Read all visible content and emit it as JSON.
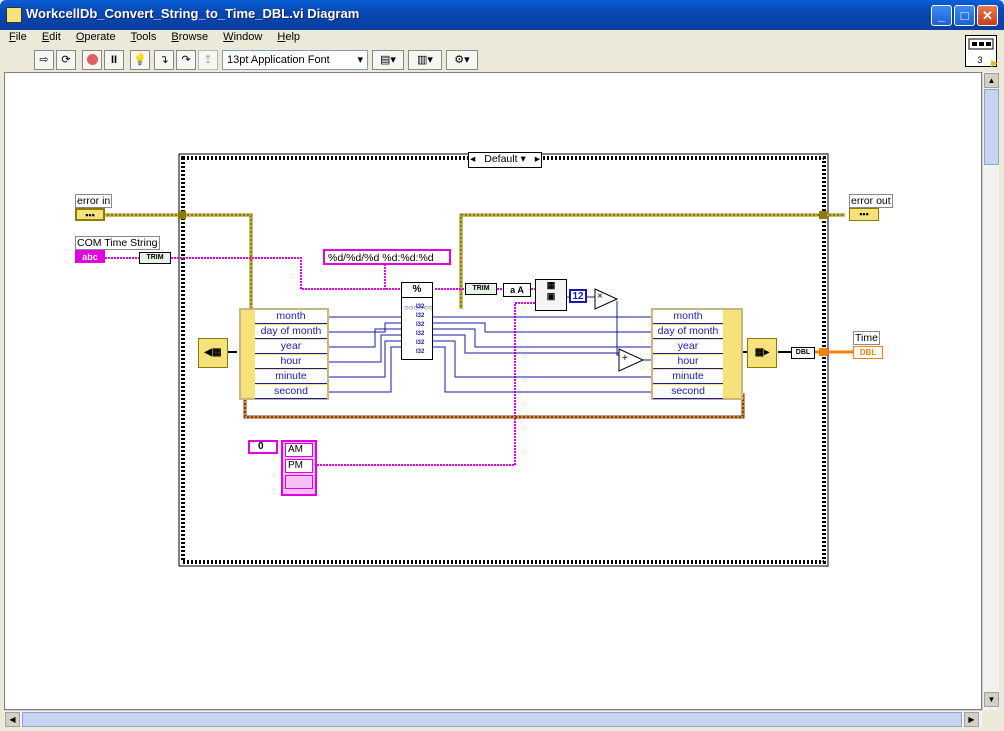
{
  "window": {
    "title": "WorkcellDb_Convert_String_to_Time_DBL.vi Diagram",
    "controls": [
      "_",
      "□",
      "✕"
    ]
  },
  "menu": [
    {
      "label": "File",
      "key": "F",
      "rest": "ile"
    },
    {
      "label": "Edit",
      "key": "E",
      "rest": "dit"
    },
    {
      "label": "Operate",
      "key": "O",
      "rest": "perate"
    },
    {
      "label": "Tools",
      "key": "T",
      "rest": "ools"
    },
    {
      "label": "Browse",
      "key": "B",
      "rest": "rowse"
    },
    {
      "label": "Window",
      "key": "W",
      "rest": "indow"
    },
    {
      "label": "Help",
      "key": "H",
      "rest": "elp"
    }
  ],
  "toolbar": {
    "font": "13pt Application Font",
    "buttons": [
      "run-arrow-icon",
      "run-continuous-icon",
      "abort-icon",
      "pause-icon",
      "highlight-execution-icon",
      "retain-wire-values-icon",
      "step-into-icon",
      "step-over-icon",
      "step-out-icon"
    ]
  },
  "connector": {
    "number": "3"
  },
  "diagram": {
    "case_selector": "Default",
    "case_arrow_left": "◂",
    "case_arrow_right": "▸",
    "case_dropdown": "▾",
    "error_in": "error in",
    "error_out": "error out",
    "com_time_string": "COM Time String",
    "abc_terminal": "abc",
    "trim_label": "TRIM",
    "format_string": "%d/%d/%d %d:%d:%d",
    "scan_node_label": "%",
    "const_12": "12",
    "multiply": "×",
    "add": "+",
    "uncl_left_fields": [
      "month",
      "day of month",
      "year",
      "hour",
      "minute",
      "second"
    ],
    "bundle_right_fields": [
      "month",
      "day of month",
      "year",
      "hour",
      "minute",
      "second"
    ],
    "numeric_i32": "I32",
    "enum_index": "0",
    "enum_values": [
      "AM",
      "PM"
    ],
    "dbl_label": "DBL",
    "time_label": "Time",
    "time_terminal": "DBL",
    "case_label_af": "a A"
  },
  "colors": {
    "cluster": "#8b7b00",
    "string_wire": "#e000e0",
    "numeric_wire": "#1a1aaa",
    "dbl_wire": "#ff8000",
    "frame": "#000000",
    "highlight_frame": "#f6e17a"
  }
}
